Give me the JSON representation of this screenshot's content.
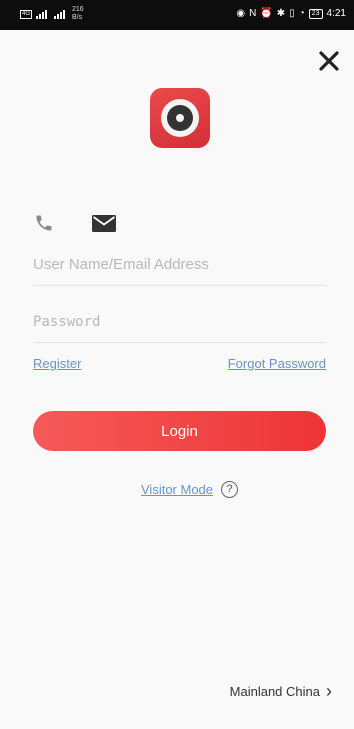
{
  "status_bar": {
    "network_left": "4G",
    "speed_value": "216",
    "speed_unit": "B/s",
    "battery": "23",
    "time": "4:21"
  },
  "login": {
    "username_placeholder": "User Name/Email Address",
    "password_placeholder": "Password",
    "register_label": "Register",
    "forgot_label": "Forgot Password",
    "login_label": "Login",
    "visitor_label": "Visitor Mode",
    "help_glyph": "?",
    "region_label": "Mainland China",
    "region_chevron": "›"
  },
  "icons": {
    "close": "close-icon",
    "phone": "phone-icon",
    "email": "envelope-icon",
    "help": "question-circle-icon"
  },
  "colors": {
    "accent_red": "#ee3436",
    "link_blue": "#6a94c8",
    "logo_red": "#d42f3a"
  }
}
